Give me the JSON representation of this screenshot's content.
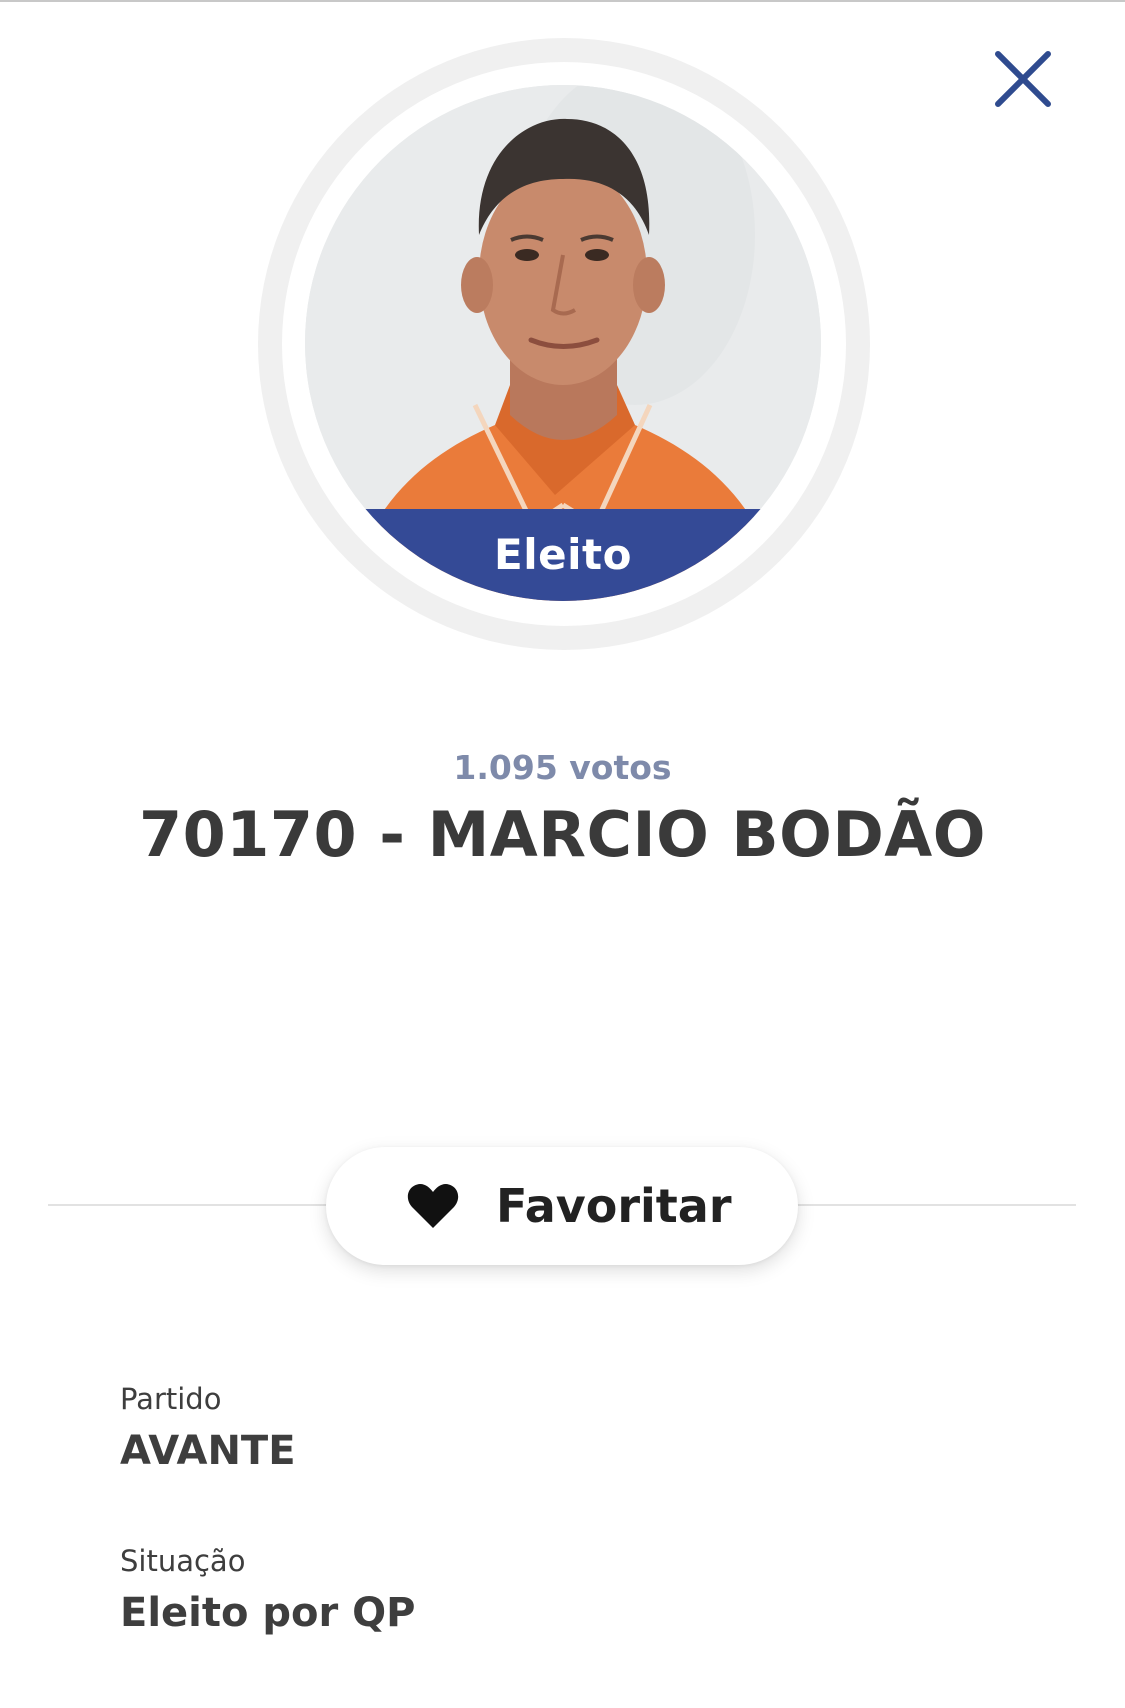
{
  "header": {
    "close_icon": "close-icon"
  },
  "candidate": {
    "status_badge": "Eleito",
    "votes": "1.095 votos",
    "title": "70170 - MARCIO BODÃO"
  },
  "actions": {
    "favorite_label": "Favoritar",
    "favorite_icon": "heart-icon"
  },
  "details": [
    {
      "label": "Partido",
      "value": "AVANTE"
    },
    {
      "label": "Situação",
      "value": "Eleito por QP"
    }
  ],
  "colors": {
    "accent": "#344a96",
    "close_icon": "#2f4b8f",
    "votes_text": "#7e8aaa",
    "shirt": "#ea7b3a"
  }
}
